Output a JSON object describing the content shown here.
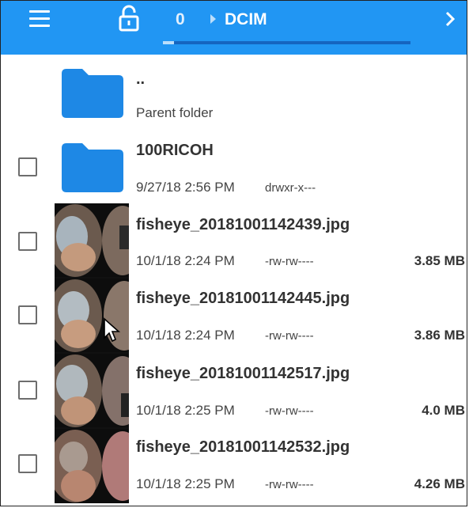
{
  "toolbar": {
    "menu_icon": "hamburger-menu-icon",
    "lock_icon": "unlocked-padlock-icon",
    "breadcrumb": [
      "0",
      "DCIM"
    ],
    "next_icon": "chevron-right-icon",
    "colors": {
      "bar": "#2196f3",
      "track": "#1565c0"
    }
  },
  "entries": [
    {
      "type": "parent",
      "name": "..",
      "subtitle": "Parent folder",
      "icon": "folder-icon"
    },
    {
      "type": "folder",
      "name": "100RICOH",
      "date": "9/27/18 2:56 PM",
      "perm": "drwxr-x---",
      "icon": "folder-icon"
    },
    {
      "type": "file",
      "name": "fisheye_20181001142439.jpg",
      "date": "10/1/18 2:24 PM",
      "perm": "-rw-rw----",
      "size": "3.85 MB"
    },
    {
      "type": "file",
      "name": "fisheye_20181001142445.jpg",
      "date": "10/1/18 2:24 PM",
      "perm": "-rw-rw----",
      "size": "3.86 MB"
    },
    {
      "type": "file",
      "name": "fisheye_20181001142517.jpg",
      "date": "10/1/18 2:25 PM",
      "perm": "-rw-rw----",
      "size": "4.0 MB"
    },
    {
      "type": "file",
      "name": "fisheye_20181001142532.jpg",
      "date": "10/1/18 2:25 PM",
      "perm": "-rw-rw----",
      "size": "4.26 MB"
    }
  ]
}
